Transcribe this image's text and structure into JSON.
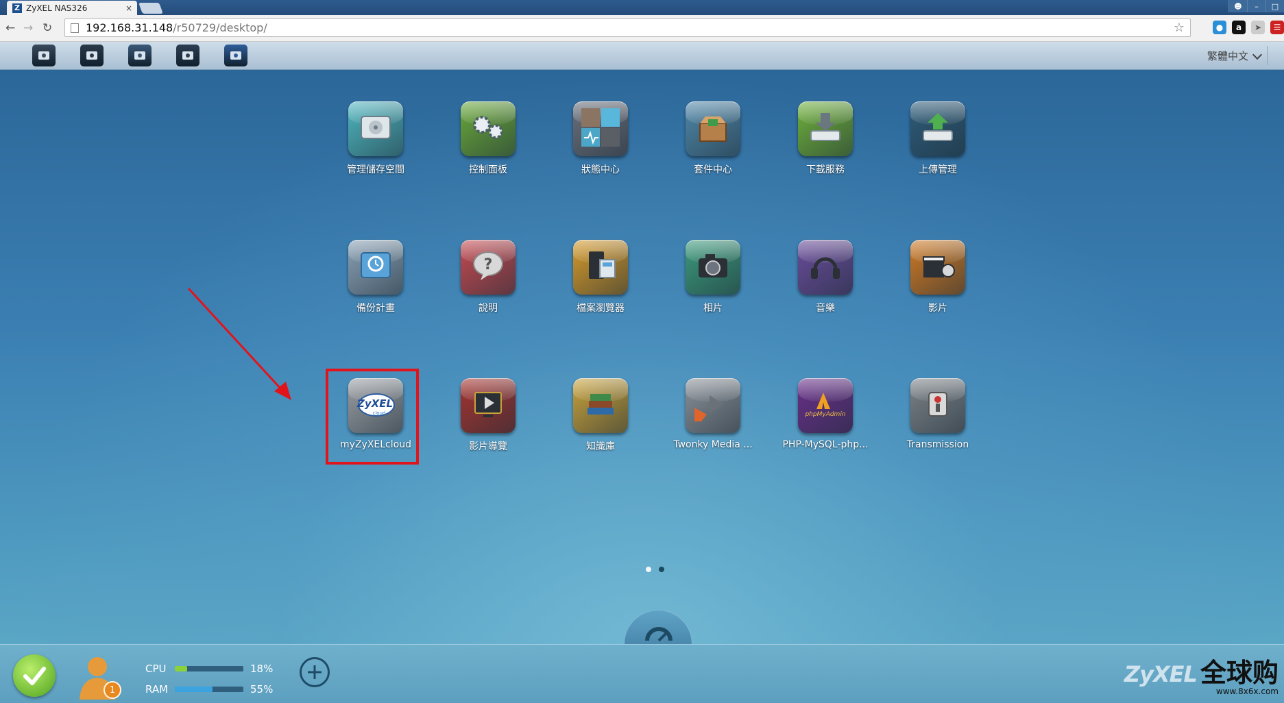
{
  "browser": {
    "tab_title": "ZyXEL NAS326",
    "tab_favicon": "Z",
    "tab_close": "×",
    "url_host": "192.168.31.148",
    "url_path": "/r50729/desktop/"
  },
  "topbar": {
    "quick_launch": [
      {
        "name": "file-browser-icon",
        "color": "#3b4a5c"
      },
      {
        "name": "photo-camera-icon",
        "color": "#2a3a4a"
      },
      {
        "name": "music-icon",
        "color": "#3b5a7a"
      },
      {
        "name": "video-icon",
        "color": "#2d3e52"
      },
      {
        "name": "zyxel-cloud-icon",
        "color": "#2f5f9a"
      }
    ],
    "language": "繁體中文"
  },
  "apps": [
    {
      "label": "管理儲存空間",
      "icon": "storage-manager-icon",
      "color": "#4fb7c0"
    },
    {
      "label": "控制面板",
      "icon": "control-panel-icon",
      "color": "#6aa83a"
    },
    {
      "label": "狀態中心",
      "icon": "status-center-icon",
      "color": "#6b6f7a"
    },
    {
      "label": "套件中心",
      "icon": "package-center-icon",
      "color": "#4f87a8"
    },
    {
      "label": "下載服務",
      "icon": "download-service-icon",
      "color": "#6fb03a"
    },
    {
      "label": "上傳管理",
      "icon": "upload-manager-icon",
      "color": "#2e5c79"
    },
    {
      "label": "備份計畫",
      "icon": "backup-planner-icon",
      "color": "#8aa1b5"
    },
    {
      "label": "說明",
      "icon": "help-icon",
      "color": "#c54a50"
    },
    {
      "label": "檔案瀏覽器",
      "icon": "file-browser-icon",
      "color": "#d69a2a"
    },
    {
      "label": "相片",
      "icon": "photo-icon",
      "color": "#3c9a7b"
    },
    {
      "label": "音樂",
      "icon": "music-icon",
      "color": "#6a4c9a"
    },
    {
      "label": "影片",
      "icon": "video-icon",
      "color": "#d07a24"
    },
    {
      "label": "myZyXELcloud",
      "icon": "myzyxelcloud-icon",
      "color": "#9a9ea3"
    },
    {
      "label": "影片導覽",
      "icon": "video-tour-icon",
      "color": "#a6342f"
    },
    {
      "label": "知識庫",
      "icon": "knowledge-base-icon",
      "color": "#c9a23a"
    },
    {
      "label": "Twonky Media ...",
      "icon": "twonky-media-icon",
      "color": "#8a9098"
    },
    {
      "label": "PHP-MySQL-php...",
      "icon": "phpmyadmin-icon",
      "color": "#6a2f8a"
    },
    {
      "label": "Transmission",
      "icon": "transmission-icon",
      "color": "#7d8388"
    }
  ],
  "tile_text": {
    "zyxel": "ZyXEL",
    "cloud": "cloud",
    "phpmyadmin": "phpMyAdmin",
    "help": "?"
  },
  "status": {
    "user_count": "1",
    "cpu_label": "CPU",
    "cpu_percent": "18%",
    "cpu_fraction": 0.18,
    "ram_label": "RAM",
    "ram_percent": "55%",
    "ram_fraction": 0.55
  },
  "page_indicator": {
    "pages": 2,
    "current": 1
  },
  "watermark": {
    "brand_left": "ZyXEL",
    "brand_right": "全球购",
    "url": "www.8x6x.com"
  }
}
